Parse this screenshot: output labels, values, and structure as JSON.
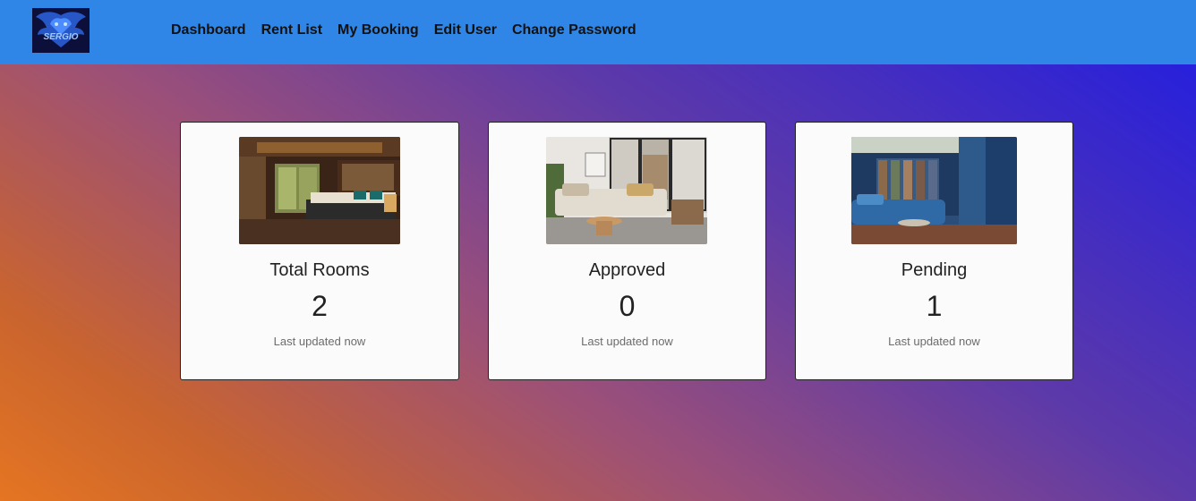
{
  "brand": {
    "logo_text": "SERGIO"
  },
  "nav": {
    "items": [
      {
        "label": "Dashboard"
      },
      {
        "label": "Rent List"
      },
      {
        "label": "My Booking"
      },
      {
        "label": "Edit User"
      },
      {
        "label": "Change Password"
      }
    ]
  },
  "cards": [
    {
      "title": "Total Rooms",
      "value": "2",
      "footer": "Last updated now"
    },
    {
      "title": "Approved",
      "value": "0",
      "footer": "Last updated now"
    },
    {
      "title": "Pending",
      "value": "1",
      "footer": "Last updated now"
    }
  ],
  "colors": {
    "navbar": "#2f86e6",
    "gradient_start": "#1f1ce3",
    "gradient_end": "#e57522"
  }
}
